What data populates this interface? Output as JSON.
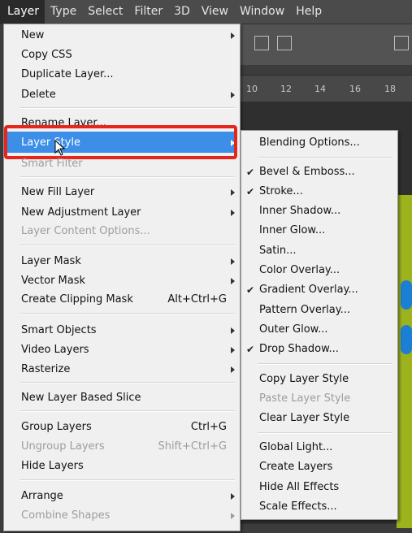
{
  "menubar": {
    "items": [
      "Layer",
      "Type",
      "Select",
      "Filter",
      "3D",
      "View",
      "Window",
      "Help"
    ]
  },
  "ruler": {
    "numbers": [
      "10",
      "12",
      "14",
      "16",
      "18"
    ]
  },
  "layer_menu": {
    "new": "New",
    "copy_css": "Copy CSS",
    "duplicate_layer": "Duplicate Layer...",
    "delete": "Delete",
    "rename_layer": "Rename Layer...",
    "layer_style": "Layer Style",
    "smart_filter": "Smart Filter",
    "new_fill_layer": "New Fill Layer",
    "new_adjustment_layer": "New Adjustment Layer",
    "layer_content_options": "Layer Content Options...",
    "layer_mask": "Layer Mask",
    "vector_mask": "Vector Mask",
    "create_clipping_mask": "Create Clipping Mask",
    "create_clipping_mask_shortcut": "Alt+Ctrl+G",
    "smart_objects": "Smart Objects",
    "video_layers": "Video Layers",
    "rasterize": "Rasterize",
    "new_layer_based_slice": "New Layer Based Slice",
    "group_layers": "Group Layers",
    "group_layers_shortcut": "Ctrl+G",
    "ungroup_layers": "Ungroup Layers",
    "ungroup_layers_shortcut": "Shift+Ctrl+G",
    "hide_layers": "Hide Layers",
    "arrange": "Arrange",
    "combine_shapes": "Combine Shapes"
  },
  "layer_style_submenu": {
    "blending_options": "Blending Options...",
    "bevel_emboss": "Bevel & Emboss...",
    "stroke": "Stroke...",
    "inner_shadow": "Inner Shadow...",
    "inner_glow": "Inner Glow...",
    "satin": "Satin...",
    "color_overlay": "Color Overlay...",
    "gradient_overlay": "Gradient Overlay...",
    "pattern_overlay": "Pattern Overlay...",
    "outer_glow": "Outer Glow...",
    "drop_shadow": "Drop Shadow...",
    "copy_layer_style": "Copy Layer Style",
    "paste_layer_style": "Paste Layer Style",
    "clear_layer_style": "Clear Layer Style",
    "global_light": "Global Light...",
    "create_layers": "Create Layers",
    "hide_all_effects": "Hide All Effects",
    "scale_effects": "Scale Effects...",
    "check_mark": "✔"
  },
  "colors": {
    "highlight": "#3d8ee6",
    "annotation_border": "#e5261d",
    "menu_bg": "#f0f0f0",
    "canvas_green": "#9db31e"
  }
}
